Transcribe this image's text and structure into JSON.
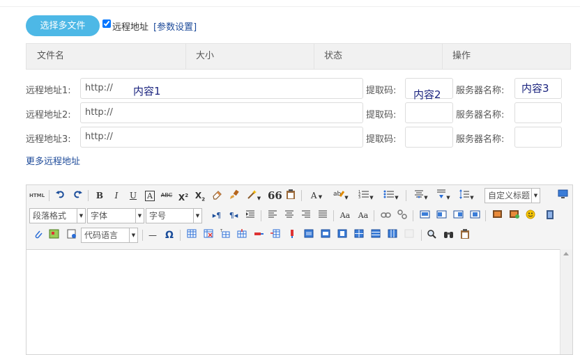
{
  "upload": {
    "pick_button": "选择多文件",
    "remote_checkbox_label": "远程地址",
    "remote_checked": true,
    "param_link": "[参数设置]"
  },
  "table": {
    "headers": [
      "文件名",
      "大小",
      "状态",
      "操作"
    ]
  },
  "remote_rows": [
    {
      "label": "远程地址1:",
      "url_value": "http://",
      "code_label": "提取码:",
      "server_label": "服务器名称:"
    },
    {
      "label": "远程地址2:",
      "url_value": "http://",
      "code_label": "提取码:",
      "server_label": "服务器名称:"
    },
    {
      "label": "远程地址3:",
      "url_value": "http://",
      "code_label": "提取码:",
      "server_label": "服务器名称:"
    }
  ],
  "overlays": {
    "content1": "内容1",
    "content2": "内容2",
    "content3": "内容3"
  },
  "more_link": "更多远程地址",
  "editor": {
    "html_button": "HTML",
    "bold": "B",
    "italic": "I",
    "underline": "U",
    "strikethrough": "ABC",
    "font_border": "A",
    "quote": "66",
    "font_color": "A",
    "custom_heading": "自定义标题",
    "paragraph_format": "段落格式",
    "font_family": "字体",
    "font_size": "字号",
    "code_language": "代码语言",
    "horizontal_rule": "—",
    "special_char": "Ω"
  },
  "colors": {
    "accent": "#4db8e6",
    "link": "#1e4b9a",
    "overlay_text": "#1a237e",
    "toolbar_bg": "#f4f4f4"
  }
}
